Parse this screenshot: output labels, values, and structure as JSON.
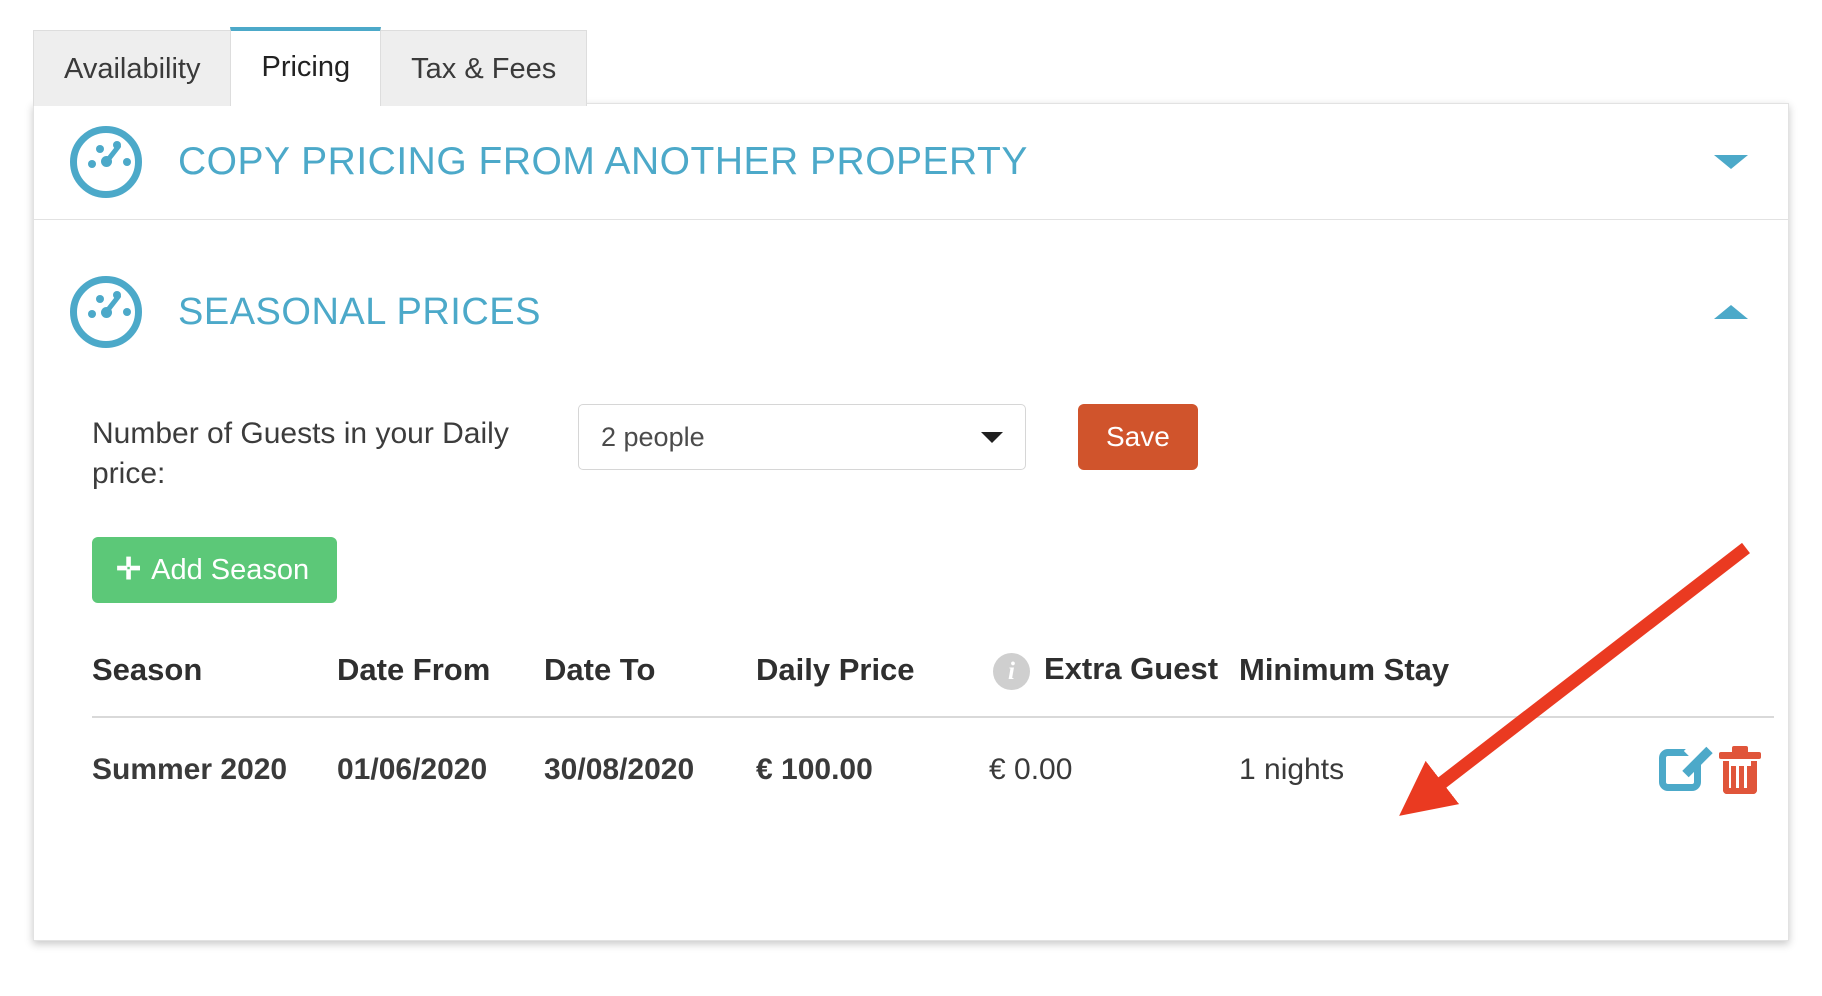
{
  "tabs": [
    {
      "label": "Availability",
      "active": false
    },
    {
      "label": "Pricing",
      "active": true
    },
    {
      "label": "Tax & Fees",
      "active": false
    }
  ],
  "panels": {
    "copy_pricing": {
      "title": "COPY PRICING FROM ANOTHER PROPERTY",
      "icon": "gauge-icon",
      "collapsed": true,
      "chevron": "chevron-down-icon"
    },
    "seasonal_prices": {
      "title": "SEASONAL PRICES",
      "icon": "gauge-icon",
      "collapsed": false,
      "chevron": "chevron-up-icon"
    }
  },
  "form": {
    "guests_label": "Number of Guests in your Daily price:",
    "guests_select": {
      "value": "2 people",
      "caret": "caret-down-icon"
    },
    "save_label": "Save",
    "add_season_label": "Add Season",
    "add_season_icon": "plus-icon"
  },
  "table": {
    "headers": {
      "season": "Season",
      "date_from": "Date From",
      "date_to": "Date To",
      "daily_price": "Daily Price",
      "info_icon": "info-icon",
      "info_glyph": "i",
      "extra_guest": "Extra Guest",
      "minimum_stay": "Minimum Stay"
    },
    "rows": [
      {
        "season": "Summer 2020",
        "date_from": "01/06/2020",
        "date_to": "30/08/2020",
        "daily_price": "€ 100.00",
        "extra_guest": "€ 0.00",
        "minimum_stay": "1 nights",
        "edit_icon": "edit-icon",
        "delete_icon": "trash-icon"
      }
    ]
  },
  "annotation": {
    "type": "arrow",
    "color": "#ea3a21",
    "points_to": "edit-icon"
  },
  "colors": {
    "accent_blue": "#4ca9c9",
    "save_orange": "#d0542c",
    "add_green": "#5cc878",
    "delete_red": "#e0553a",
    "annotation_red": "#ea3a21"
  }
}
